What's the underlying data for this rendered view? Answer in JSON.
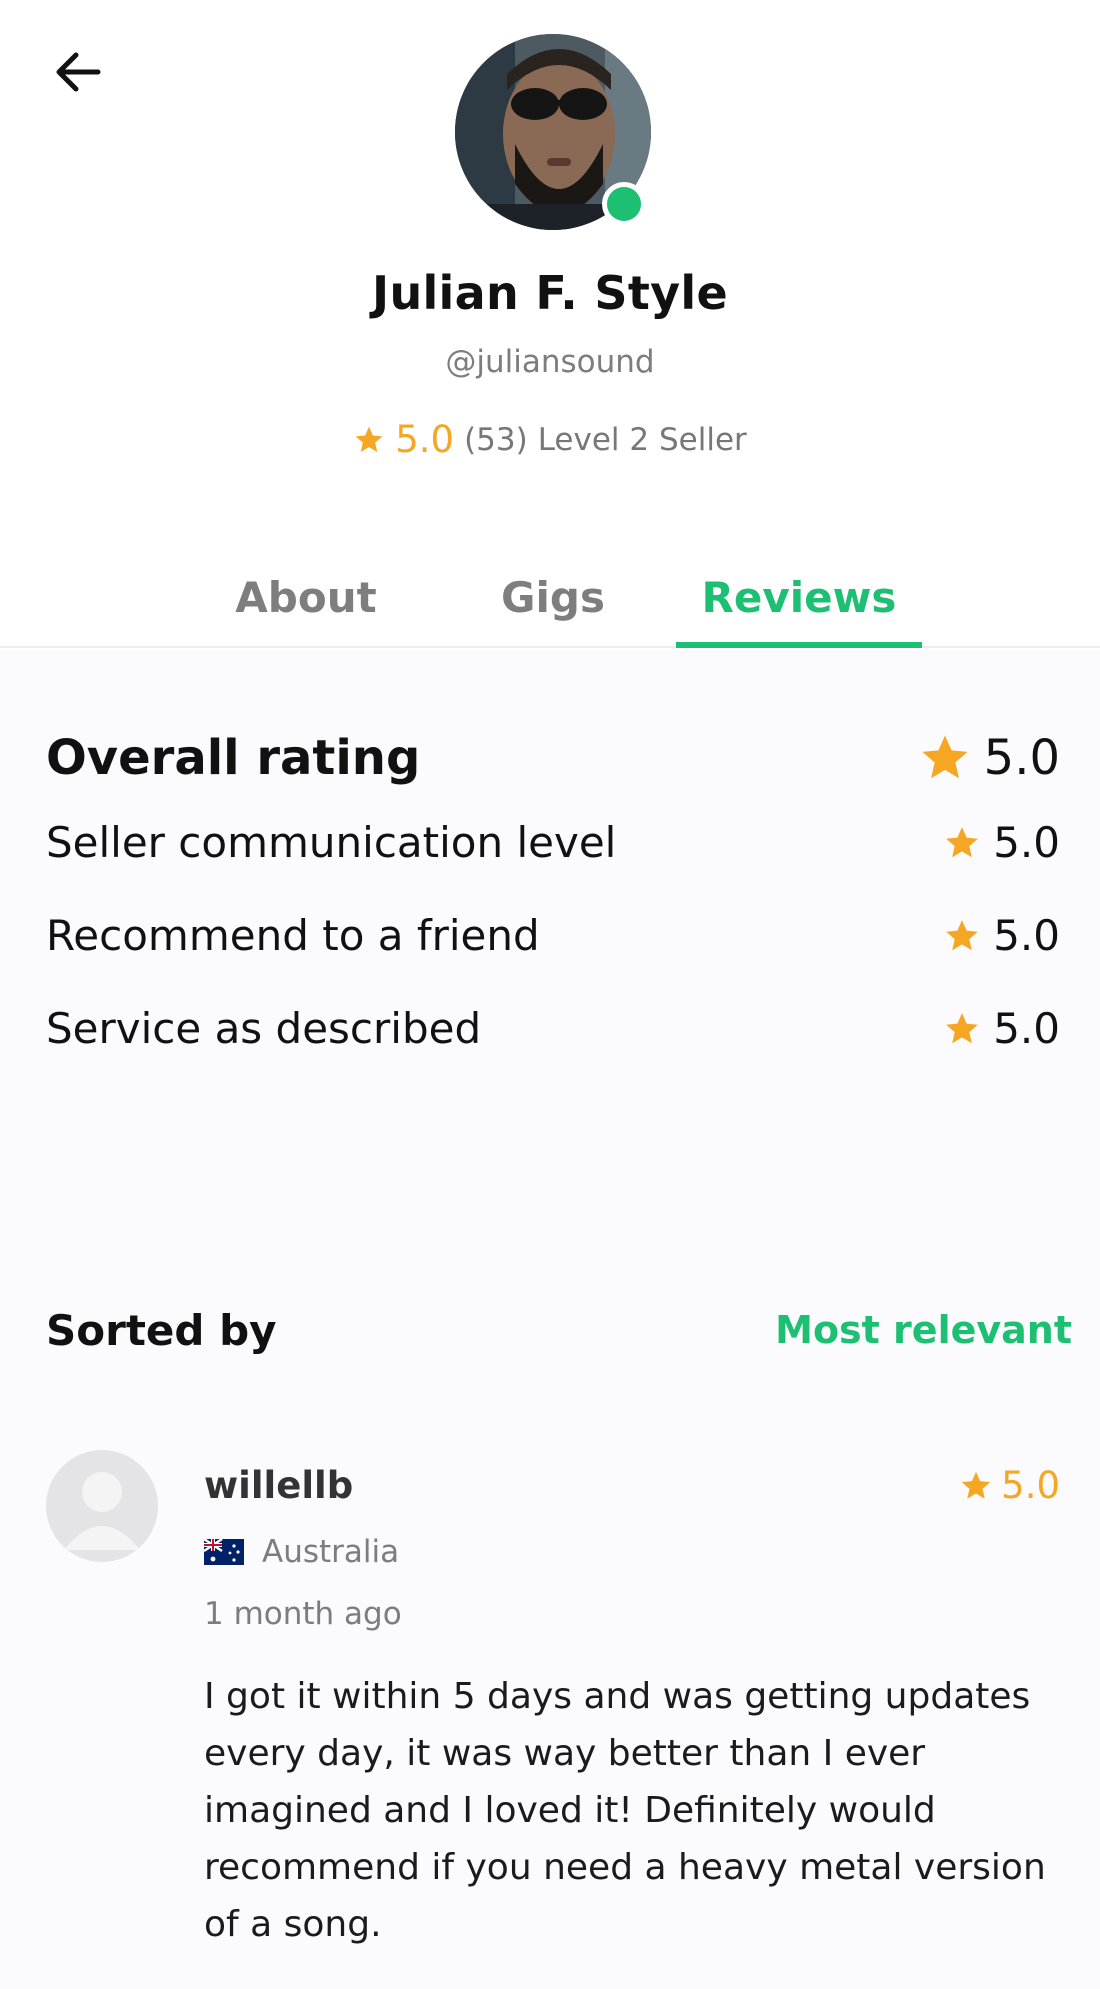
{
  "profile": {
    "name": "Julian F. Style",
    "handle": "@juliansound",
    "rating": "5.0",
    "review_count": "(53)",
    "level": "Level 2 Seller",
    "online": true
  },
  "tabs": [
    {
      "label": "About",
      "active": false
    },
    {
      "label": "Gigs",
      "active": false
    },
    {
      "label": "Reviews",
      "active": true
    }
  ],
  "ratings": {
    "overall": {
      "label": "Overall rating",
      "value": "5.0"
    },
    "items": [
      {
        "label": "Seller communication level",
        "value": "5.0"
      },
      {
        "label": "Recommend to a friend",
        "value": "5.0"
      },
      {
        "label": "Service as described",
        "value": "5.0"
      }
    ]
  },
  "sort": {
    "label": "Sorted by",
    "value": "Most relevant"
  },
  "reviews": [
    {
      "user": "willellb",
      "rating": "5.0",
      "country": "Australia",
      "time": "1 month ago",
      "text": "I got it within 5 days and was getting updates every day, it was way better than I ever imagined and I loved it! Definitely would recommend if you need a heavy metal version of a song."
    }
  ],
  "icons": {
    "back": "arrow-left-icon",
    "star": "star-icon",
    "flag": "australia-flag-icon"
  },
  "colors": {
    "accent": "#1dbf73",
    "star": "#f5a623",
    "muted": "#7d7d7d"
  }
}
